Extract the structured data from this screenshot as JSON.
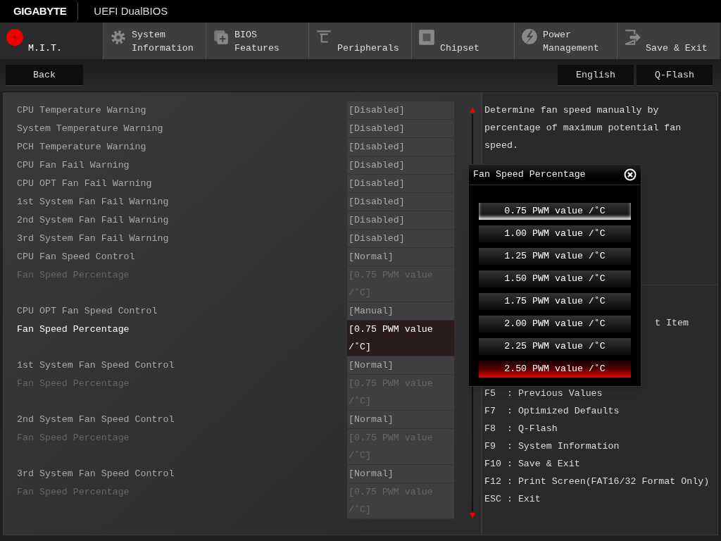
{
  "header": {
    "brand": "GIGABYTE",
    "title": "UEFI DualBIOS"
  },
  "tabs": [
    {
      "label": "M.I.T.",
      "selected": true
    },
    {
      "label": "System\nInformation",
      "selected": false
    },
    {
      "label": "BIOS\nFeatures",
      "selected": false
    },
    {
      "label": "Peripherals",
      "selected": false
    },
    {
      "label": "Chipset",
      "selected": false
    },
    {
      "label": "Power\nManagement",
      "selected": false
    },
    {
      "label": "Save & Exit",
      "selected": false
    }
  ],
  "back_button": "Back",
  "right_buttons": [
    "English",
    "Q-Flash"
  ],
  "settings": [
    {
      "label": "CPU Temperature Warning",
      "value": "[Disabled]",
      "disabled": false,
      "selected": false
    },
    {
      "label": "System Temperature Warning",
      "value": "[Disabled]",
      "disabled": false,
      "selected": false
    },
    {
      "label": "PCH Temperature Warning",
      "value": "[Disabled]",
      "disabled": false,
      "selected": false
    },
    {
      "label": "CPU Fan Fail Warning",
      "value": "[Disabled]",
      "disabled": false,
      "selected": false
    },
    {
      "label": "CPU OPT Fan Fail Warning",
      "value": "[Disabled]",
      "disabled": false,
      "selected": false
    },
    {
      "label": "1st System Fan Fail Warning",
      "value": "[Disabled]",
      "disabled": false,
      "selected": false
    },
    {
      "label": "2nd System Fan Fail Warning",
      "value": "[Disabled]",
      "disabled": false,
      "selected": false
    },
    {
      "label": "3rd System Fan Fail Warning",
      "value": "[Disabled]",
      "disabled": false,
      "selected": false
    },
    {
      "label": "CPU Fan Speed Control",
      "value": "[Normal]",
      "disabled": false,
      "selected": false
    },
    {
      "label": "Fan Speed Percentage",
      "value": "[0.75 PWM value /˚C]",
      "disabled": true,
      "selected": false
    },
    {
      "label": "CPU OPT Fan Speed Control",
      "value": "[Manual]",
      "disabled": false,
      "selected": false
    },
    {
      "label": "Fan Speed Percentage",
      "value": "[0.75 PWM value /˚C]",
      "disabled": false,
      "selected": true
    },
    {
      "label": "1st System Fan Speed Control",
      "value": "[Normal]",
      "disabled": false,
      "selected": false
    },
    {
      "label": "Fan Speed Percentage",
      "value": "[0.75 PWM value /˚C]",
      "disabled": true,
      "selected": false
    },
    {
      "label": "2nd System Fan Speed Control",
      "value": "[Normal]",
      "disabled": false,
      "selected": false
    },
    {
      "label": "Fan Speed Percentage",
      "value": "[0.75 PWM value /˚C]",
      "disabled": true,
      "selected": false
    },
    {
      "label": "3rd System Fan Speed Control",
      "value": "[Normal]",
      "disabled": false,
      "selected": false
    },
    {
      "label": "Fan Speed Percentage",
      "value": "[0.75 PWM value /˚C]",
      "disabled": true,
      "selected": false
    }
  ],
  "help": {
    "description": "Determine fan speed manually by percentage of maximum potential fan speed.",
    "keys": [
      {
        "text": "t Item",
        "kind": "cut"
      },
      {
        "text": "F5  : Previous Values",
        "kind": "line"
      },
      {
        "text": "F7  : Optimized Defaults",
        "kind": "line"
      },
      {
        "text": "F8  : Q-Flash",
        "kind": "line"
      },
      {
        "text": "F9  : System Information",
        "kind": "line"
      },
      {
        "text": "F10 : Save & Exit",
        "kind": "line"
      },
      {
        "text": "F12 : Print Screen(FAT16/32 Format Only)",
        "kind": "line"
      },
      {
        "text": "ESC : Exit",
        "kind": "line"
      }
    ]
  },
  "popup": {
    "title": "Fan Speed Percentage",
    "options": [
      {
        "label": "0.75 PWM value /˚C",
        "selected": true,
        "focused": false
      },
      {
        "label": "1.00 PWM value /˚C",
        "selected": false,
        "focused": false
      },
      {
        "label": "1.25 PWM value /˚C",
        "selected": false,
        "focused": false
      },
      {
        "label": "1.50 PWM value /˚C",
        "selected": false,
        "focused": false
      },
      {
        "label": "1.75 PWM value /˚C",
        "selected": false,
        "focused": false
      },
      {
        "label": "2.00 PWM value /˚C",
        "selected": false,
        "focused": false
      },
      {
        "label": "2.25 PWM value /˚C",
        "selected": false,
        "focused": false
      },
      {
        "label": "2.50 PWM value /˚C",
        "selected": false,
        "focused": true
      }
    ]
  }
}
